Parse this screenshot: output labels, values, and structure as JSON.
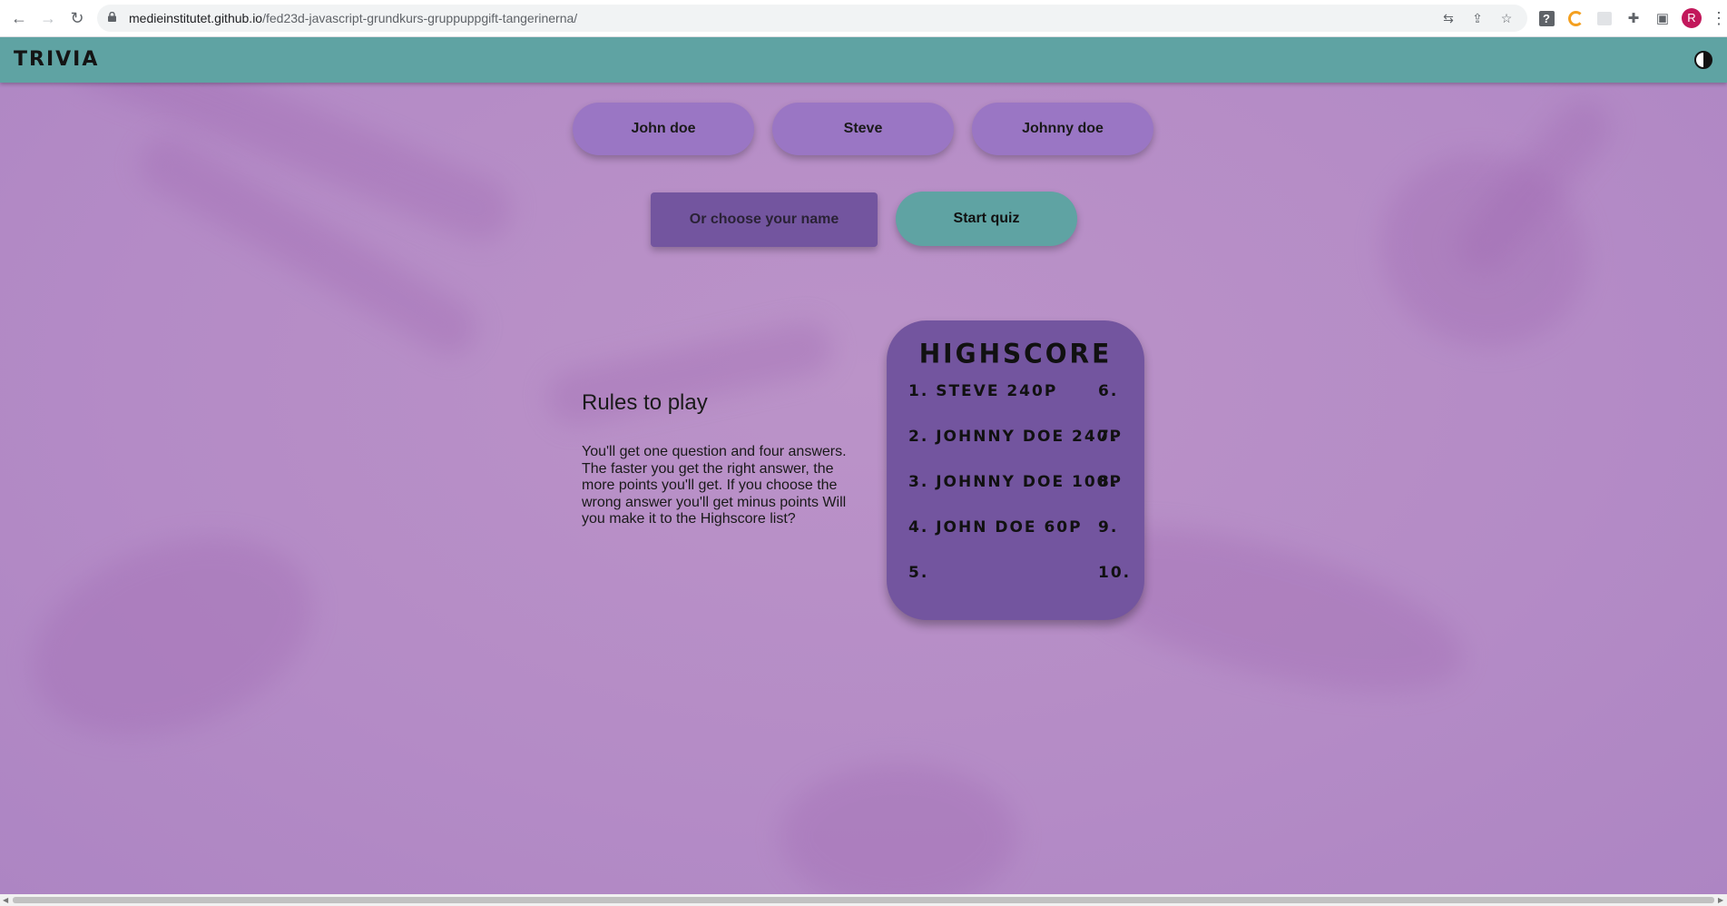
{
  "browser": {
    "url_host": "medieinstitutet.github.io",
    "url_path": "/fed23d-javascript-grundkurs-gruppuppgift-tangerinerna/",
    "avatar_letter": "R"
  },
  "header": {
    "logo": "TRIVIA"
  },
  "players": {
    "names": [
      "John doe",
      "Steve",
      "Johnny doe"
    ],
    "input_placeholder": "Or choose your name",
    "start_label": "Start quiz"
  },
  "rules": {
    "title": "Rules to play",
    "text": "You'll get one question and four answers. The faster you get the right answer, the more points you'll get. If you choose the wrong answer you'll get minus points Will you make it to the Highscore list?"
  },
  "highscore": {
    "title": "HIGHSCORE",
    "left": [
      "1. STEVE 240P",
      "2. JOHNNY DOE 240P",
      "3. JOHNNY DOE 100P",
      "4. JOHN DOE 60P",
      "5."
    ],
    "right": [
      "6.",
      "7.",
      "8.",
      "9.",
      "10."
    ]
  },
  "colors": {
    "header": "#5fa3a3",
    "name_button": "#9a76c4",
    "dark_purple": "#73559f",
    "background": "#b78dc5"
  }
}
